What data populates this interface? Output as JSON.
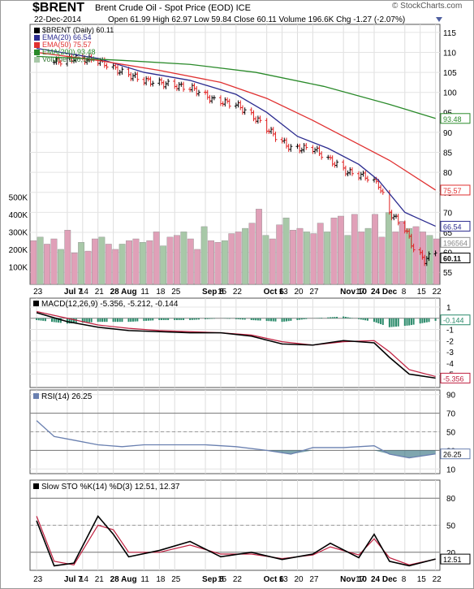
{
  "header": {
    "symbol": "$BRENT",
    "description": "Brent Crude Oil - Spot Price (EOD)  ICE",
    "date": "22-Dec-2014",
    "ohlc_text": "Open 61.99  High 62.97  Low 59.84  Close 60.11  Volume 196.6K  Chg -1.27 (-2.07%)",
    "credit": "© StockCharts.com"
  },
  "colors": {
    "ema20": "#2b2b8f",
    "ema50": "#e03030",
    "ema200": "#2a8a2a",
    "volume_up": "#a8c8a8",
    "volume_down": "#e0a0b8",
    "price_up": "#000000",
    "price_down": "#e02020",
    "macd_line": "#000000",
    "macd_signal": "#c02040",
    "macd_hist": "#2a8a6a",
    "rsi_line": "#6a80b0",
    "rsi_fill": "#2a6a7a",
    "sto_k": "#000000",
    "sto_d": "#c02040"
  },
  "chart_data": [
    {
      "type": "ohlc",
      "title": "$BRENT (Daily) 60.11",
      "price_axis_ticks": [
        55,
        60,
        65,
        70,
        75,
        80,
        85,
        90,
        95,
        100,
        105,
        110,
        115
      ],
      "price_ylim": [
        52,
        117
      ],
      "volume_ticks": [
        "100K",
        "200K",
        "300K",
        "400K",
        "500K"
      ],
      "volume_tick_values": [
        100,
        200,
        300,
        400,
        500
      ],
      "volume_ylim_k": [
        0,
        520
      ],
      "x_tick_labels": [
        "23",
        "Jul 7",
        "14",
        "21",
        "28 Aug",
        "11",
        "18",
        "25",
        "Sep 8",
        "15",
        "22",
        "Oct 6",
        "13",
        "20",
        "27",
        "Nov 10",
        "17",
        "24 Dec",
        "8",
        "15",
        "22"
      ],
      "x_tick_dates": [
        "2014-06-23",
        "2014-07-07",
        "2014-07-14",
        "2014-07-21",
        "2014-07-28",
        "2014-08-11",
        "2014-08-18",
        "2014-08-25",
        "2014-09-08",
        "2014-09-15",
        "2014-09-22",
        "2014-10-06",
        "2014-10-13",
        "2014-10-20",
        "2014-10-27",
        "2014-11-10",
        "2014-11-17",
        "2014-11-24",
        "2014-12-08",
        "2014-12-15",
        "2014-12-22"
      ],
      "legend": [
        {
          "label": "$BRENT (Daily) 60.11",
          "color": "#000000"
        },
        {
          "label": "EMA(20) 66.54",
          "color": "#2b2b8f"
        },
        {
          "label": "EMA(50) 75.57",
          "color": "#e03030"
        },
        {
          "label": "EMA(200) 93.48",
          "color": "#2a8a2a"
        },
        {
          "label": "Volume 196,564",
          "color": "#a8c8a8"
        }
      ],
      "right_labels": {
        "ema200": "93.48",
        "ema50": "75.57",
        "ema20": "66.54",
        "volume": "196564",
        "close": "60.11"
      },
      "series": [
        {
          "name": "Close",
          "x": [
            "2014-07-01",
            "2014-07-10",
            "2014-07-21",
            "2014-08-01",
            "2014-08-11",
            "2014-08-22",
            "2014-09-02",
            "2014-09-12",
            "2014-09-22",
            "2014-10-02",
            "2014-10-10",
            "2014-10-17",
            "2014-10-27",
            "2014-11-04",
            "2014-11-12",
            "2014-11-20",
            "2014-11-26",
            "2014-12-01",
            "2014-12-08",
            "2014-12-12",
            "2014-12-17",
            "2014-12-22"
          ],
          "values": [
            107.5,
            108.5,
            108,
            105,
            103,
            102,
            101,
            98,
            97,
            93,
            89,
            86,
            86,
            83,
            80,
            79,
            77,
            70,
            66,
            61,
            58,
            60.11
          ]
        },
        {
          "name": "EMA(20)",
          "x": [
            "2014-06-23",
            "2014-07-21",
            "2014-08-11",
            "2014-09-01",
            "2014-09-22",
            "2014-10-06",
            "2014-10-20",
            "2014-11-03",
            "2014-11-17",
            "2014-11-26",
            "2014-12-08",
            "2014-12-22"
          ],
          "values": [
            111,
            108.5,
            105,
            103,
            99.5,
            95,
            89,
            86,
            82,
            78,
            70,
            66.54
          ]
        },
        {
          "name": "EMA(50)",
          "x": [
            "2014-06-23",
            "2014-07-21",
            "2014-08-18",
            "2014-09-15",
            "2014-10-06",
            "2014-10-27",
            "2014-11-17",
            "2014-12-01",
            "2014-12-22"
          ],
          "values": [
            110,
            108,
            105.5,
            102.5,
            98.5,
            93,
            87,
            83,
            75.57
          ]
        },
        {
          "name": "EMA(200)",
          "x": [
            "2014-06-23",
            "2014-08-01",
            "2014-09-01",
            "2014-10-01",
            "2014-11-01",
            "2014-12-01",
            "2014-12-22"
          ],
          "values": [
            109,
            108,
            107,
            105,
            101.5,
            97,
            93.48
          ]
        }
      ],
      "volume_k": [
        250,
        270,
        230,
        260,
        200,
        310,
        180,
        240,
        190,
        260,
        270,
        230,
        200,
        230,
        250,
        260,
        240,
        250,
        300,
        220,
        270,
        280,
        300,
        260,
        200,
        330,
        250,
        240,
        250,
        290,
        300,
        320,
        350,
        430,
        280,
        260,
        340,
        380,
        310,
        320,
        300,
        290,
        350,
        300,
        380,
        390,
        280,
        400,
        300,
        320,
        400,
        270,
        410,
        300,
        360,
        320,
        330,
        300,
        280,
        260
      ]
    },
    {
      "type": "line",
      "title": "MACD(12,26,9) -5.356, -5.212, -0.144",
      "yticks": [
        1,
        0,
        -1,
        -2,
        -3,
        -4,
        -5
      ],
      "ylim": [
        -6.2,
        1.8
      ],
      "right_labels": {
        "histogram": "-0.144",
        "macd": "-5.356"
      },
      "series": [
        {
          "name": "MACD",
          "x": [
            "2014-06-23",
            "2014-07-07",
            "2014-07-21",
            "2014-08-04",
            "2014-08-18",
            "2014-09-01",
            "2014-09-15",
            "2014-09-29",
            "2014-10-13",
            "2014-10-27",
            "2014-11-10",
            "2014-11-24",
            "2014-12-01",
            "2014-12-10",
            "2014-12-22"
          ],
          "values": [
            0.5,
            -0.3,
            -0.8,
            -1.1,
            -1.2,
            -1.3,
            -1.3,
            -1.6,
            -2.3,
            -2.4,
            -2.0,
            -2.2,
            -3.5,
            -5.0,
            -5.356
          ]
        },
        {
          "name": "Signal",
          "x": [
            "2014-06-23",
            "2014-07-07",
            "2014-07-21",
            "2014-08-04",
            "2014-08-18",
            "2014-09-01",
            "2014-09-15",
            "2014-09-29",
            "2014-10-13",
            "2014-10-27",
            "2014-11-10",
            "2014-11-24",
            "2014-12-01",
            "2014-12-10",
            "2014-12-22"
          ],
          "values": [
            0.6,
            0.0,
            -0.6,
            -0.9,
            -1.1,
            -1.2,
            -1.3,
            -1.5,
            -2.1,
            -2.4,
            -2.1,
            -2.0,
            -3.0,
            -4.6,
            -5.212
          ]
        }
      ]
    },
    {
      "type": "line",
      "title": "RSI(14) 26.25",
      "yticks": [
        90,
        70,
        50,
        30,
        10
      ],
      "ylim": [
        5,
        95
      ],
      "reference_lines": [
        70,
        30
      ],
      "right_labels": {
        "rsi": "26.25"
      },
      "series": [
        {
          "name": "RSI",
          "x": [
            "2014-06-23",
            "2014-07-01",
            "2014-07-10",
            "2014-07-21",
            "2014-08-01",
            "2014-08-11",
            "2014-08-25",
            "2014-09-08",
            "2014-09-22",
            "2014-10-06",
            "2014-10-17",
            "2014-10-27",
            "2014-11-10",
            "2014-11-24",
            "2014-12-01",
            "2014-12-10",
            "2014-12-22"
          ],
          "values": [
            62,
            45,
            41,
            36,
            34,
            36,
            36,
            36,
            34,
            30,
            26,
            33,
            33,
            35,
            26,
            22,
            26.25
          ]
        }
      ]
    },
    {
      "type": "line",
      "title": "Slow STO %K(14) %D(3) 12.51, 12.37",
      "yticks": [
        80,
        50,
        20
      ],
      "ylim": [
        0,
        100
      ],
      "reference_lines": [
        80,
        20
      ],
      "right_labels": {
        "k": "12.51"
      },
      "series": [
        {
          "name": "%K",
          "x": [
            "2014-06-23",
            "2014-07-01",
            "2014-07-10",
            "2014-07-21",
            "2014-07-28",
            "2014-08-04",
            "2014-08-18",
            "2014-09-01",
            "2014-09-15",
            "2014-09-29",
            "2014-10-13",
            "2014-10-27",
            "2014-11-04",
            "2014-11-17",
            "2014-11-24",
            "2014-12-01",
            "2014-12-10",
            "2014-12-22"
          ],
          "values": [
            55,
            5,
            8,
            60,
            40,
            15,
            22,
            32,
            15,
            20,
            12,
            18,
            30,
            14,
            40,
            10,
            5,
            12.51
          ]
        },
        {
          "name": "%D",
          "x": [
            "2014-06-23",
            "2014-07-01",
            "2014-07-10",
            "2014-07-21",
            "2014-07-28",
            "2014-08-04",
            "2014-08-18",
            "2014-09-01",
            "2014-09-15",
            "2014-09-29",
            "2014-10-13",
            "2014-10-27",
            "2014-11-04",
            "2014-11-17",
            "2014-11-24",
            "2014-12-01",
            "2014-12-10",
            "2014-12-22"
          ],
          "values": [
            60,
            10,
            6,
            50,
            45,
            20,
            20,
            28,
            18,
            18,
            13,
            17,
            26,
            17,
            35,
            14,
            6,
            12.37
          ]
        }
      ]
    }
  ]
}
